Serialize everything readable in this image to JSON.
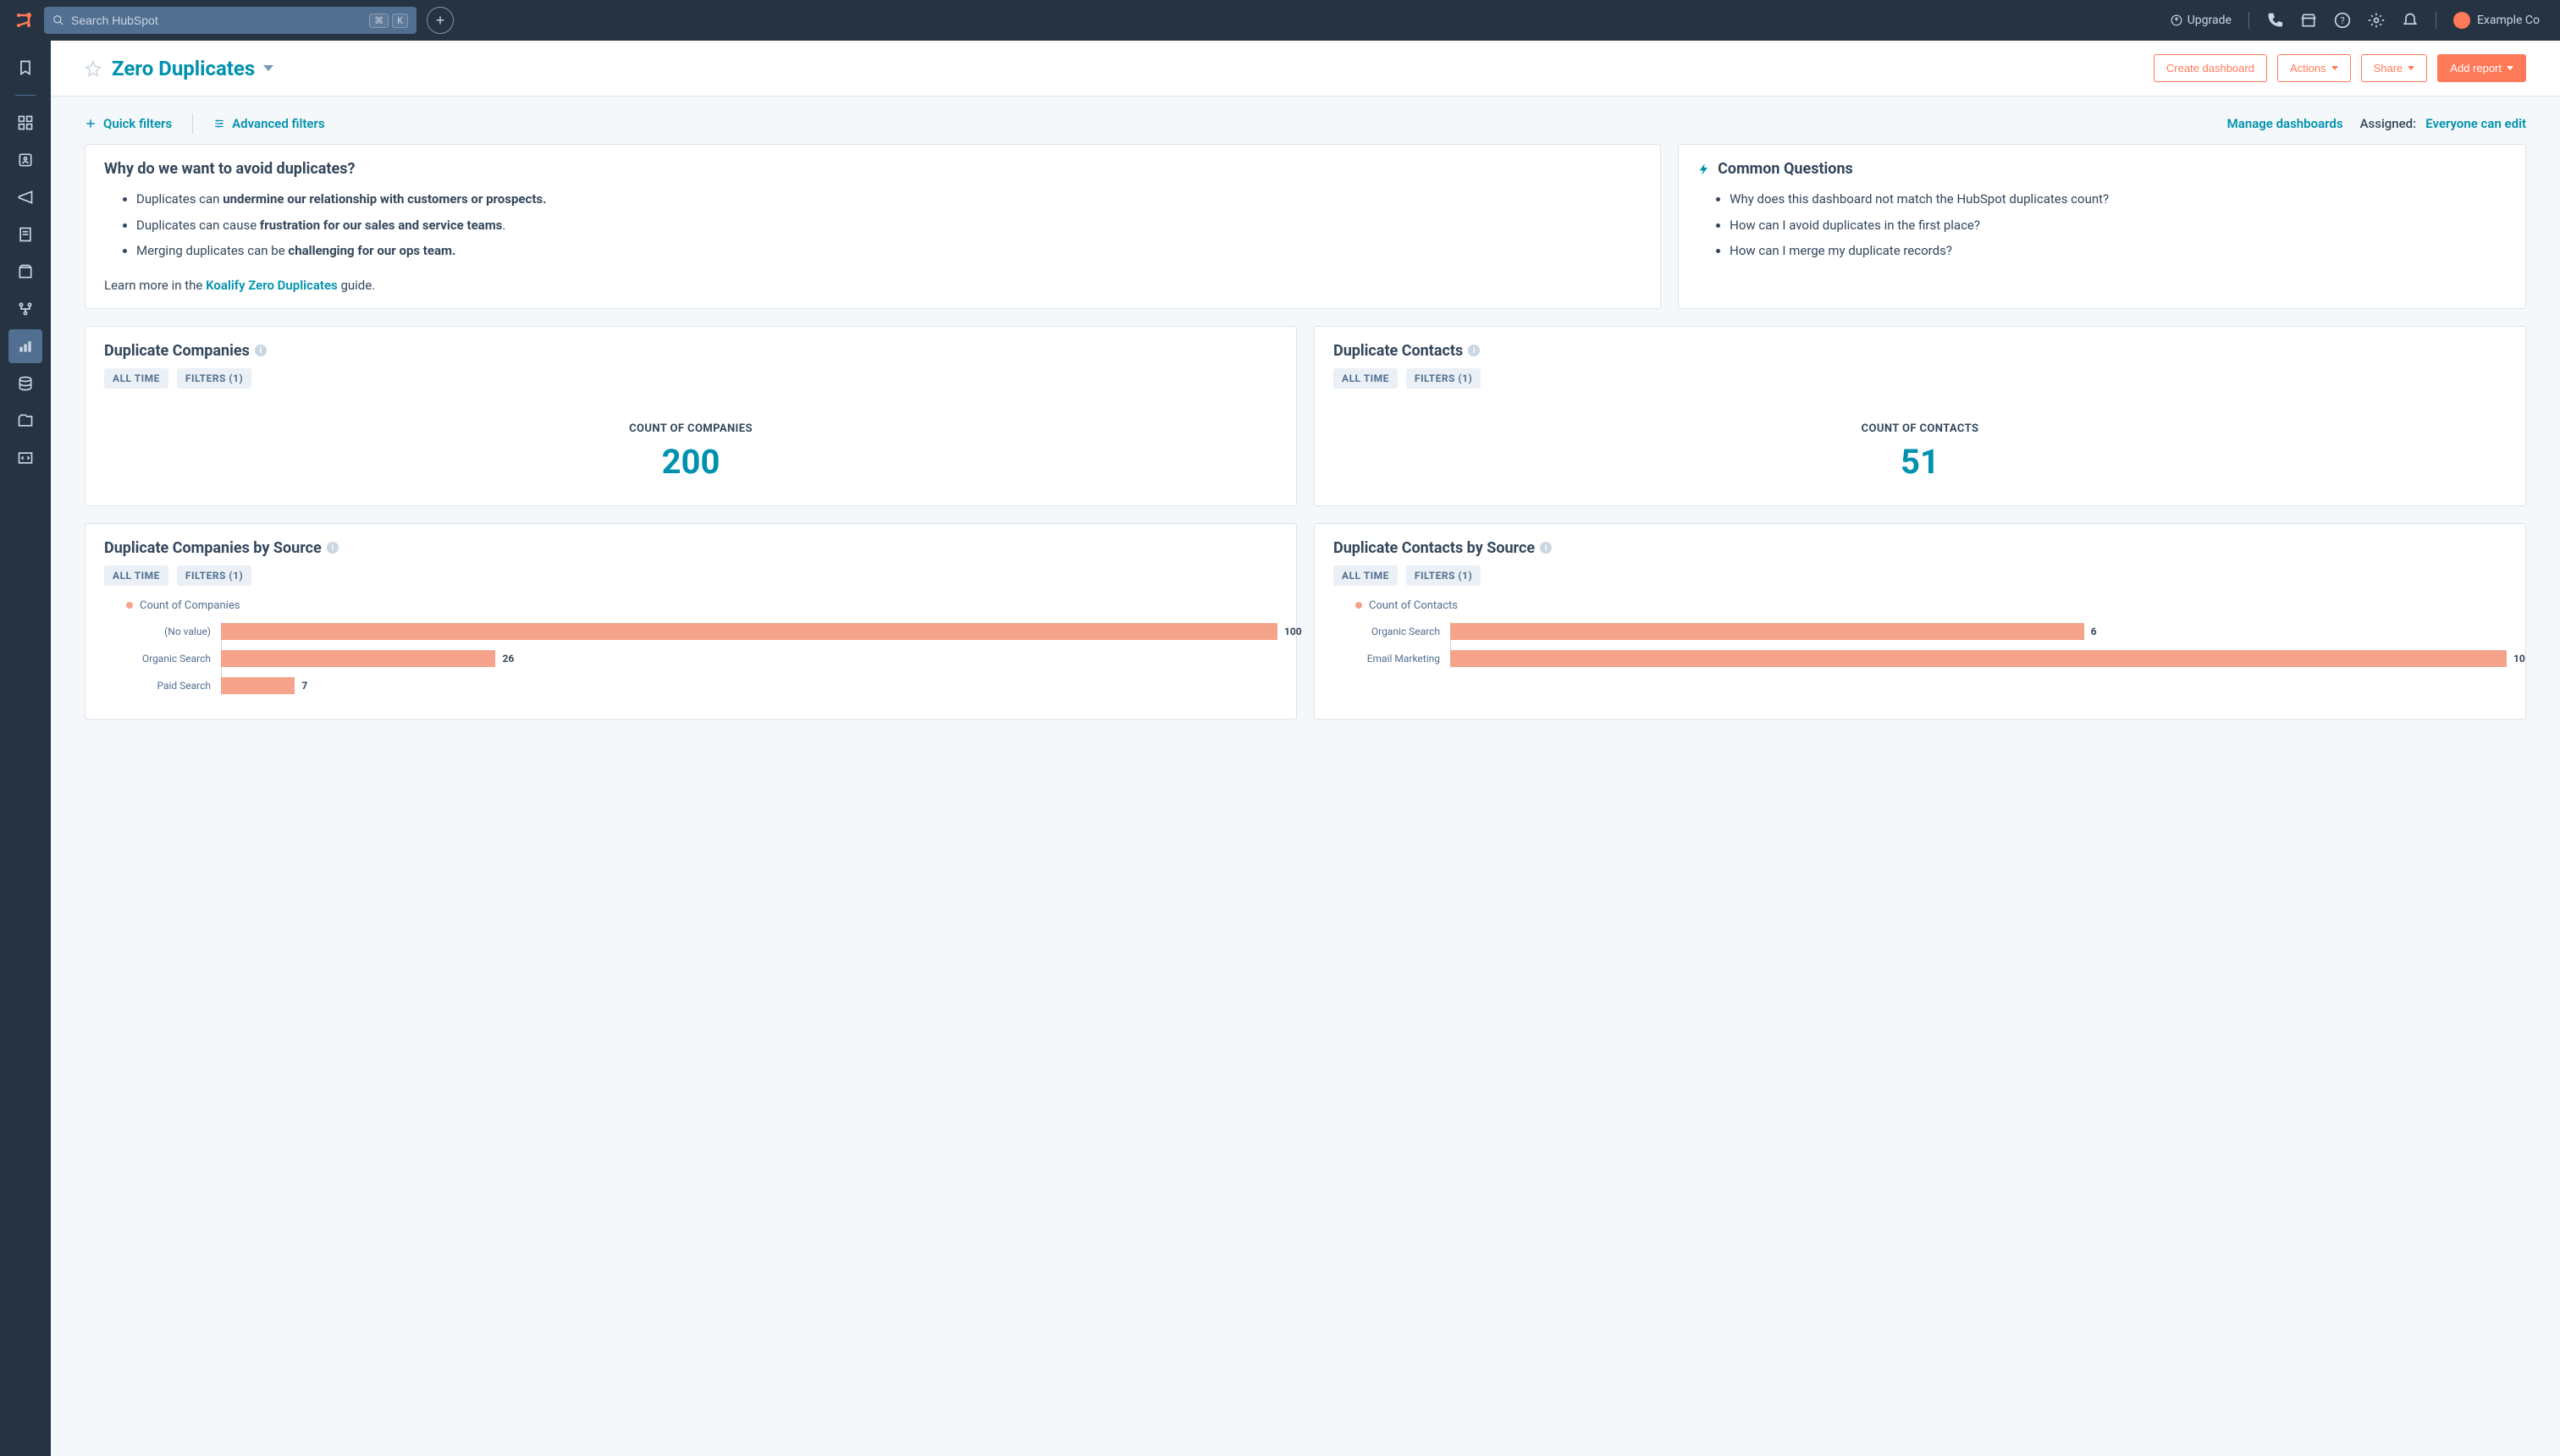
{
  "topnav": {
    "search_placeholder": "Search HubSpot",
    "kbd_cmd": "⌘",
    "kbd_k": "K",
    "upgrade": "Upgrade",
    "account_name": "Example Co"
  },
  "header": {
    "title": "Zero Duplicates",
    "actions": {
      "create": "Create dashboard",
      "actions": "Actions",
      "share": "Share",
      "add_report": "Add report"
    }
  },
  "filters": {
    "quick": "Quick filters",
    "advanced": "Advanced filters",
    "manage": "Manage dashboards",
    "assigned_label": "Assigned:",
    "assigned_value": "Everyone can edit"
  },
  "why_card": {
    "title": "Why do we want to avoid duplicates?",
    "bullets": [
      {
        "pre": "Duplicates can ",
        "bold": "undermine our relationship with customers or prospects.",
        "post": ""
      },
      {
        "pre": "Duplicates can cause ",
        "bold": "frustration for our sales and service teams",
        "post": "."
      },
      {
        "pre": "Merging duplicates can be ",
        "bold": "challenging for our ops team.",
        "post": ""
      }
    ],
    "learn_pre": "Learn more in the ",
    "learn_link": "Koalify Zero Duplicates",
    "learn_post": " guide."
  },
  "questions_card": {
    "title": "Common Questions",
    "items": [
      "Why does this dashboard not match the HubSpot duplicates count?",
      "How can I avoid duplicates in the first place?",
      "How can I merge my duplicate records?"
    ]
  },
  "tags": {
    "all_time": "ALL TIME",
    "filters1": "FILTERS (1)"
  },
  "dup_companies": {
    "title": "Duplicate Companies",
    "metric_label": "COUNT OF COMPANIES",
    "metric_value": "200"
  },
  "dup_contacts": {
    "title": "Duplicate Contacts",
    "metric_label": "COUNT OF CONTACTS",
    "metric_value": "51"
  },
  "chart_data": [
    {
      "id": "companies_by_source",
      "type": "bar",
      "orientation": "horizontal",
      "title": "Duplicate Companies by Source",
      "legend": "Count of Companies",
      "xlabel": "",
      "ylabel": "",
      "xlim": [
        0,
        100
      ],
      "categories": [
        "(No value)",
        "Organic Search",
        "Paid Search"
      ],
      "values": [
        100,
        26,
        7
      ]
    },
    {
      "id": "contacts_by_source",
      "type": "bar",
      "orientation": "horizontal",
      "title": "Duplicate Contacts by Source",
      "legend": "Count of Contacts",
      "xlabel": "",
      "ylabel": "",
      "xlim": [
        0,
        10
      ],
      "categories": [
        "Organic Search",
        "Email Marketing"
      ],
      "values": [
        6,
        10
      ]
    }
  ]
}
